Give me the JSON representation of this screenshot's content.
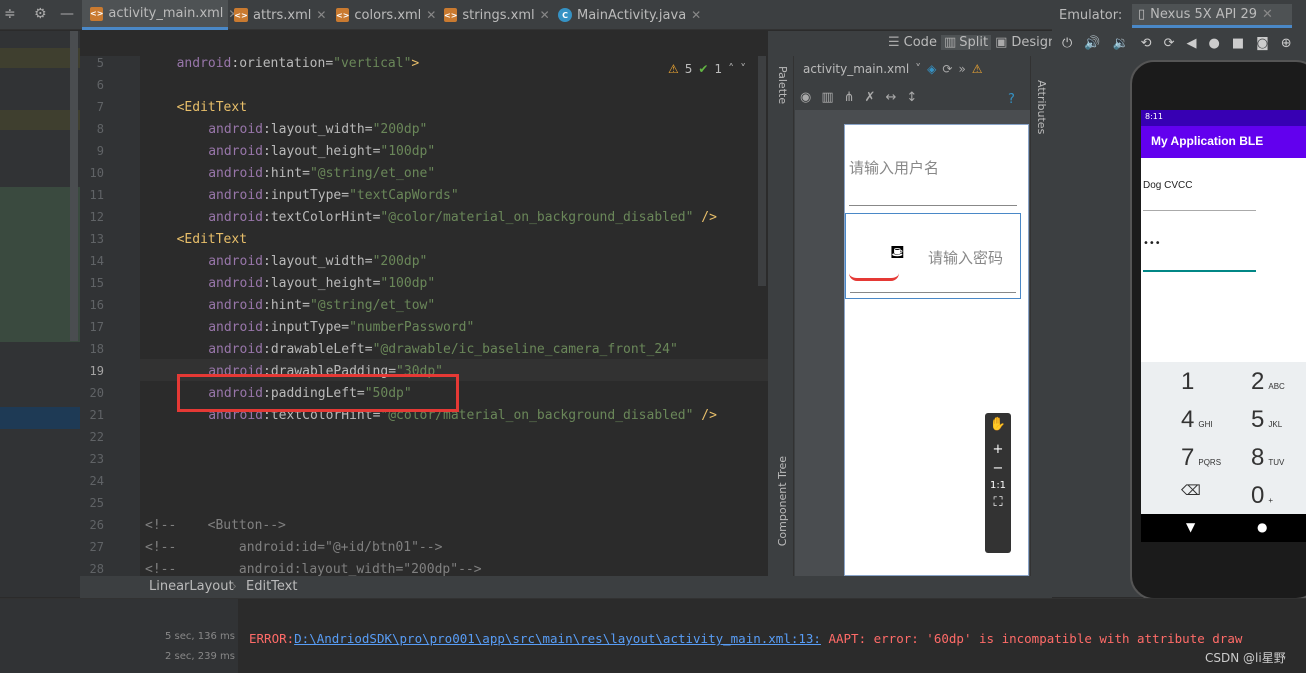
{
  "tabs": [
    {
      "label": "activity_main.xml",
      "icon": "xml-layout-icon",
      "active": true
    },
    {
      "label": "attrs.xml",
      "icon": "xml-file-icon",
      "active": false
    },
    {
      "label": "colors.xml",
      "icon": "xml-file-icon",
      "active": false
    },
    {
      "label": "strings.xml",
      "icon": "xml-file-icon",
      "active": false
    },
    {
      "label": "MainActivity.java",
      "icon": "java-class-icon",
      "active": false
    }
  ],
  "view_modes": {
    "code": "Code",
    "split": "Split",
    "design": "Design"
  },
  "inspection": {
    "warnings": "5",
    "checks": "1"
  },
  "code_lines": [
    {
      "n": "5",
      "indent": 4,
      "parts": [
        [
          "ns",
          "android"
        ],
        [
          "pl",
          ":"
        ],
        [
          "at",
          "orientation"
        ],
        [
          "pl",
          "="
        ],
        [
          "val",
          "\"vertical\""
        ],
        [
          "tag",
          ">"
        ]
      ]
    },
    {
      "n": "6",
      "indent": 0,
      "parts": []
    },
    {
      "n": "7",
      "indent": 4,
      "parts": [
        [
          "tag",
          "<EditText"
        ]
      ]
    },
    {
      "n": "8",
      "indent": 8,
      "parts": [
        [
          "ns",
          "android"
        ],
        [
          "pl",
          ":"
        ],
        [
          "at",
          "layout_width"
        ],
        [
          "pl",
          "="
        ],
        [
          "val",
          "\"200dp\""
        ]
      ]
    },
    {
      "n": "9",
      "indent": 8,
      "parts": [
        [
          "ns",
          "android"
        ],
        [
          "pl",
          ":"
        ],
        [
          "at",
          "layout_height"
        ],
        [
          "pl",
          "="
        ],
        [
          "val",
          "\"100dp\""
        ]
      ]
    },
    {
      "n": "10",
      "indent": 8,
      "parts": [
        [
          "ns",
          "android"
        ],
        [
          "pl",
          ":"
        ],
        [
          "at",
          "hint"
        ],
        [
          "pl",
          "="
        ],
        [
          "val",
          "\"@string/et_one\""
        ]
      ]
    },
    {
      "n": "11",
      "indent": 8,
      "parts": [
        [
          "ns",
          "android"
        ],
        [
          "pl",
          ":"
        ],
        [
          "at",
          "inputType"
        ],
        [
          "pl",
          "="
        ],
        [
          "val",
          "\"textCapWords\""
        ]
      ]
    },
    {
      "n": "12",
      "indent": 8,
      "parts": [
        [
          "ns",
          "android"
        ],
        [
          "pl",
          ":"
        ],
        [
          "at",
          "textColorHint"
        ],
        [
          "pl",
          "="
        ],
        [
          "val",
          "\"@color/material_on_background_disabled\""
        ],
        [
          "tag",
          " />"
        ]
      ]
    },
    {
      "n": "13",
      "indent": 4,
      "parts": [
        [
          "tag",
          "<EditText"
        ]
      ]
    },
    {
      "n": "14",
      "indent": 8,
      "parts": [
        [
          "ns",
          "android"
        ],
        [
          "pl",
          ":"
        ],
        [
          "at",
          "layout_width"
        ],
        [
          "pl",
          "="
        ],
        [
          "val",
          "\"200dp\""
        ]
      ]
    },
    {
      "n": "15",
      "indent": 8,
      "parts": [
        [
          "ns",
          "android"
        ],
        [
          "pl",
          ":"
        ],
        [
          "at",
          "layout_height"
        ],
        [
          "pl",
          "="
        ],
        [
          "val",
          "\"100dp\""
        ]
      ]
    },
    {
      "n": "16",
      "indent": 8,
      "parts": [
        [
          "ns",
          "android"
        ],
        [
          "pl",
          ":"
        ],
        [
          "at",
          "hint"
        ],
        [
          "pl",
          "="
        ],
        [
          "val",
          "\"@string/et_tow\""
        ]
      ]
    },
    {
      "n": "17",
      "indent": 8,
      "parts": [
        [
          "ns",
          "android"
        ],
        [
          "pl",
          ":"
        ],
        [
          "at",
          "inputType"
        ],
        [
          "pl",
          "="
        ],
        [
          "val",
          "\"numberPassword\""
        ]
      ]
    },
    {
      "n": "18",
      "indent": 8,
      "parts": [
        [
          "ns",
          "android"
        ],
        [
          "pl",
          ":"
        ],
        [
          "at",
          "drawableLeft"
        ],
        [
          "pl",
          "="
        ],
        [
          "val",
          "\"@drawable/ic_baseline_camera_front_24\""
        ]
      ]
    },
    {
      "n": "19",
      "indent": 8,
      "parts": [
        [
          "ns",
          "android"
        ],
        [
          "pl",
          ":"
        ],
        [
          "at",
          "drawablePadding"
        ],
        [
          "pl",
          "="
        ],
        [
          "val",
          "\"30dp\""
        ]
      ]
    },
    {
      "n": "20",
      "indent": 8,
      "parts": [
        [
          "ns",
          "android"
        ],
        [
          "pl",
          ":"
        ],
        [
          "at",
          "paddingLeft"
        ],
        [
          "pl",
          "="
        ],
        [
          "val",
          "\"50dp\""
        ]
      ]
    },
    {
      "n": "21",
      "indent": 8,
      "parts": [
        [
          "ns",
          "android"
        ],
        [
          "pl",
          ":"
        ],
        [
          "at",
          "textColorHint"
        ],
        [
          "pl",
          "="
        ],
        [
          "val",
          "\"@color/material_on_background_disabled\""
        ],
        [
          "tag",
          " />"
        ]
      ]
    },
    {
      "n": "22",
      "indent": 0,
      "parts": []
    },
    {
      "n": "23",
      "indent": 0,
      "parts": []
    },
    {
      "n": "24",
      "indent": 0,
      "parts": []
    },
    {
      "n": "25",
      "indent": 0,
      "parts": []
    },
    {
      "n": "26",
      "indent": 0,
      "parts": [
        [
          "cm",
          "<!--    <Button-->"
        ]
      ]
    },
    {
      "n": "27",
      "indent": 0,
      "parts": [
        [
          "cm",
          "<!--        android:id=\"@+id/btn01\"-->"
        ]
      ]
    },
    {
      "n": "28",
      "indent": 0,
      "parts": [
        [
          "cm",
          "<!--        android:layout_width=\"200dp\"-->"
        ]
      ]
    }
  ],
  "design": {
    "file_label": "activity_main.xml",
    "palette_label": "Palette",
    "component_tree_label": "Component Tree",
    "attributes_label": "Attributes",
    "hint_username": "请输入用户名",
    "hint_password": "请输入密码",
    "zoom_ratio": "1:1"
  },
  "emulator": {
    "label": "Emulator:",
    "device": "Nexus 5X API 29",
    "status_time": "8:11",
    "app_title": "My Application BLE",
    "username_value": "Dog CVCC",
    "password_value": "•••",
    "keys": [
      {
        "n": "1",
        "l": ""
      },
      {
        "n": "2",
        "l": "ABC"
      },
      {
        "n": "4",
        "l": "GHI"
      },
      {
        "n": "5",
        "l": "JKL"
      },
      {
        "n": "7",
        "l": "PQRS"
      },
      {
        "n": "8",
        "l": "TUV"
      },
      {
        "n": "⌫",
        "l": ""
      },
      {
        "n": "0",
        "l": "+"
      }
    ]
  },
  "breadcrumb": [
    "LinearLayout",
    "EditText"
  ],
  "build": {
    "time1": "5 sec, 136 ms",
    "time2": "2 sec, 239 ms",
    "error_prefix": "ERROR:",
    "error_path": "D:\\AndriodSDK\\pro\\pro001\\app\\src\\main\\res\\layout\\activity_main.xml:13:",
    "error_msg": " AAPT: error: '60dp' is incompatible with attribute draw"
  },
  "watermark": "CSDN @li星野",
  "colors": {
    "accent": "#4a88c7",
    "app_bar": "#6200ee",
    "error": "#ff6b68",
    "highlight_box": "#e53935"
  }
}
